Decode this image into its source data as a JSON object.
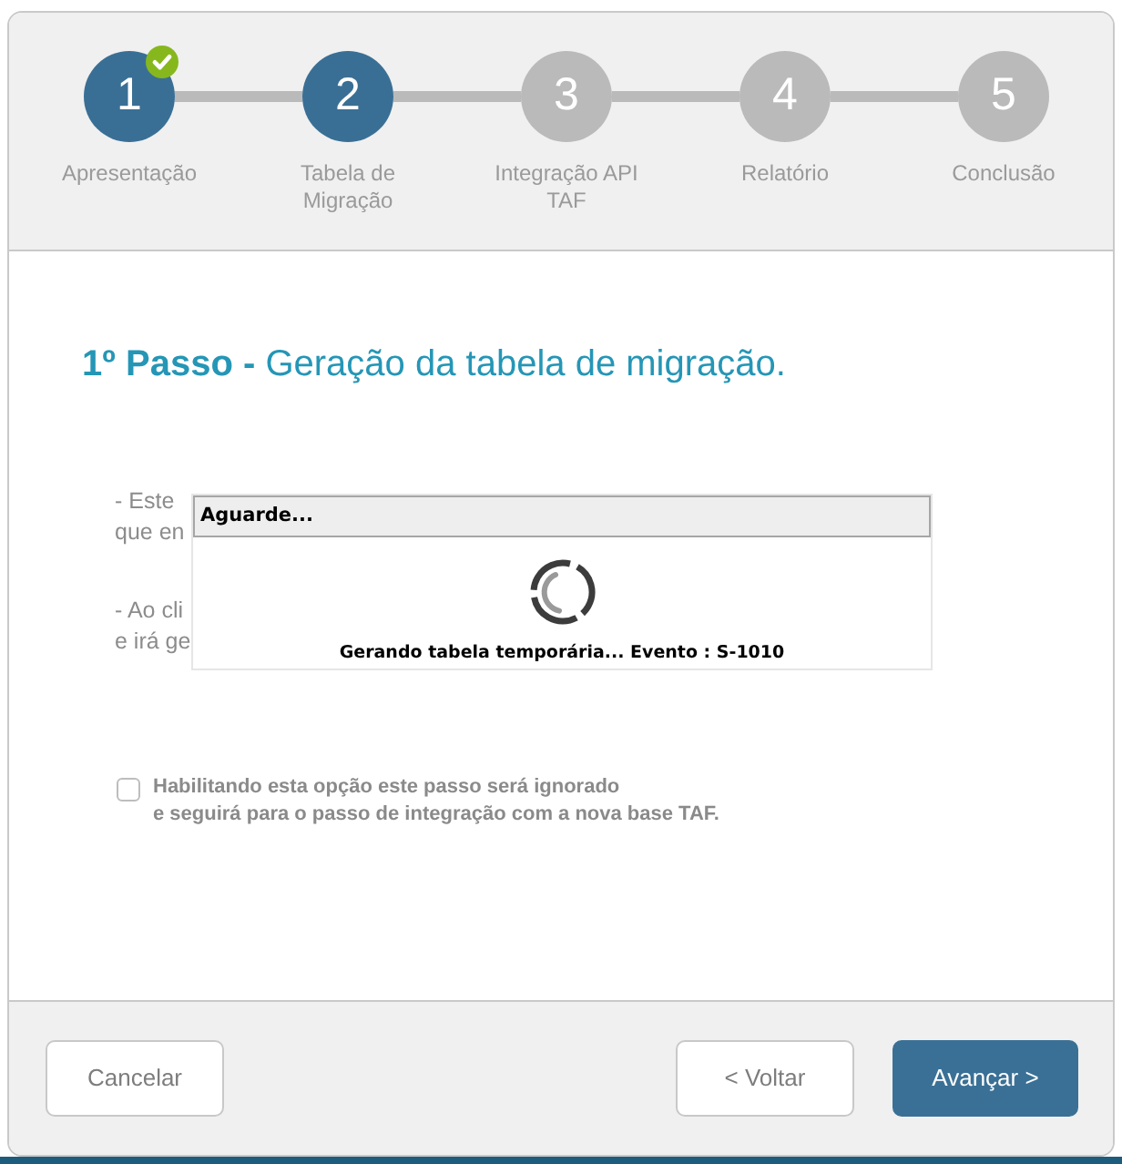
{
  "steps": [
    {
      "number": "1",
      "label": "Apresentação",
      "active": true,
      "completed": true
    },
    {
      "number": "2",
      "label": "Tabela de Migração",
      "active": true,
      "completed": false
    },
    {
      "number": "3",
      "label": "Integração API TAF",
      "active": false,
      "completed": false
    },
    {
      "number": "4",
      "label": "Relatório",
      "active": false,
      "completed": false
    },
    {
      "number": "5",
      "label": "Conclusão",
      "active": false,
      "completed": false
    }
  ],
  "title": "**1º Passo -** Geração da tabela de migração.",
  "instructions": [
    {
      "lines": [
        "- Este",
        "que en"
      ]
    },
    {
      "lines": [
        "- Ao cli",
        "e irá ge"
      ]
    }
  ],
  "skip_option": {
    "checked": false,
    "label": "Habilitando esta opção este passo será ignorado\ne seguirá para o passo de integração com a nova base TAF."
  },
  "dialog": {
    "title": "Aguarde...",
    "message": "Gerando tabela temporária... Evento : S-1010"
  },
  "buttons": [
    {
      "label": "Cancelar",
      "kind": "secondary"
    },
    {
      "label": "< Voltar",
      "kind": "secondary"
    },
    {
      "label": "Avançar >",
      "kind": "primary"
    }
  ]
}
